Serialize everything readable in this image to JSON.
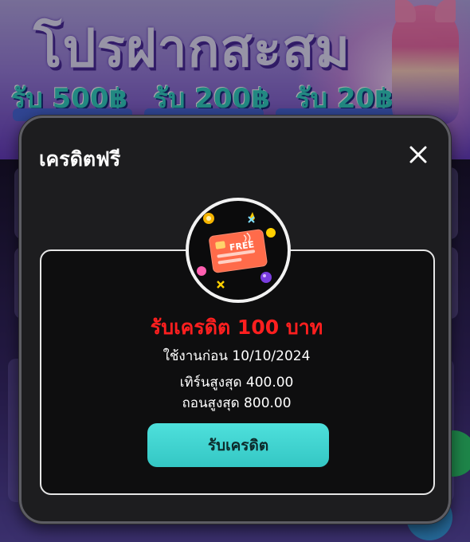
{
  "background": {
    "promo_title": "โปรฝากสะสม",
    "promo_amounts": [
      "รับ 500฿",
      "รับ 200฿",
      "รับ 20฿"
    ]
  },
  "modal": {
    "title": "เครดิตฟรี",
    "close_icon": "close-icon",
    "card_icon_label": "FREE",
    "reward_title": "รับเครดิต 100 บาท",
    "use_before": "ใช้งานก่อน 10/10/2024",
    "max_turnover": "เทิร์นสูงสุด 400.00",
    "max_withdraw": "ถอนสูงสุด 800.00",
    "claim_button": "รับเครดิต"
  },
  "colors": {
    "accent_button": "#34c7c4",
    "reward_text": "#ff1f1f",
    "modal_bg": "#1d1d1f"
  }
}
